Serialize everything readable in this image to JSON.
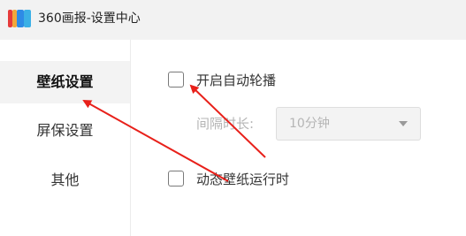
{
  "window": {
    "title": "360画报-设置中心",
    "icon": "app-logo-icon",
    "icon_colors": [
      "#e63b3b",
      "#f2a83b",
      "#2e8be6",
      "#3bb0e6"
    ]
  },
  "sidebar": {
    "items": [
      {
        "label": "壁纸设置",
        "active": true
      },
      {
        "label": "屏保设置",
        "active": false
      },
      {
        "label": "其他",
        "active": false
      }
    ]
  },
  "settings": {
    "auto_rotate": {
      "label": "开启自动轮播",
      "checked": false
    },
    "interval": {
      "label": "间隔时长:",
      "value": "10分钟",
      "disabled": true
    },
    "dynamic_wallpaper": {
      "label": "动态壁纸运行时",
      "checked": false
    }
  },
  "annotation": {
    "arrow_color": "#e8201a",
    "type": "red-arrow-annotations"
  }
}
